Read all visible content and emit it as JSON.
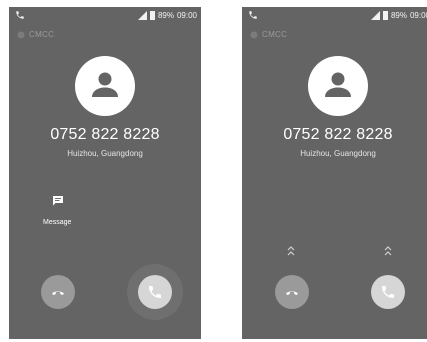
{
  "screens": [
    {
      "id": "left",
      "status_bar": {
        "battery": "89%",
        "time": "09:00"
      },
      "carrier": "CMCC",
      "phone_number": "0752 822 8228",
      "location": "Huizhou, Guangdong",
      "message_label": "Message"
    },
    {
      "id": "right",
      "status_bar": {
        "battery": "89%",
        "time": "09:00"
      },
      "carrier": "CMCC",
      "phone_number": "0752 822 8228",
      "location": "Huizhou, Guangdong"
    }
  ],
  "colors": {
    "screen_bg": "#646464",
    "decline_button": "#9a9a9a",
    "answer_button": "#d6d6d6",
    "avatar_bg": "#ffffff"
  },
  "icons": {
    "phone_status": "phone-icon",
    "signal": "signal-icon",
    "battery": "battery-icon",
    "avatar": "person-icon",
    "message": "message-icon",
    "swipe_up": "chevron-up-icon",
    "decline": "decline-call-icon",
    "answer": "answer-call-icon"
  }
}
